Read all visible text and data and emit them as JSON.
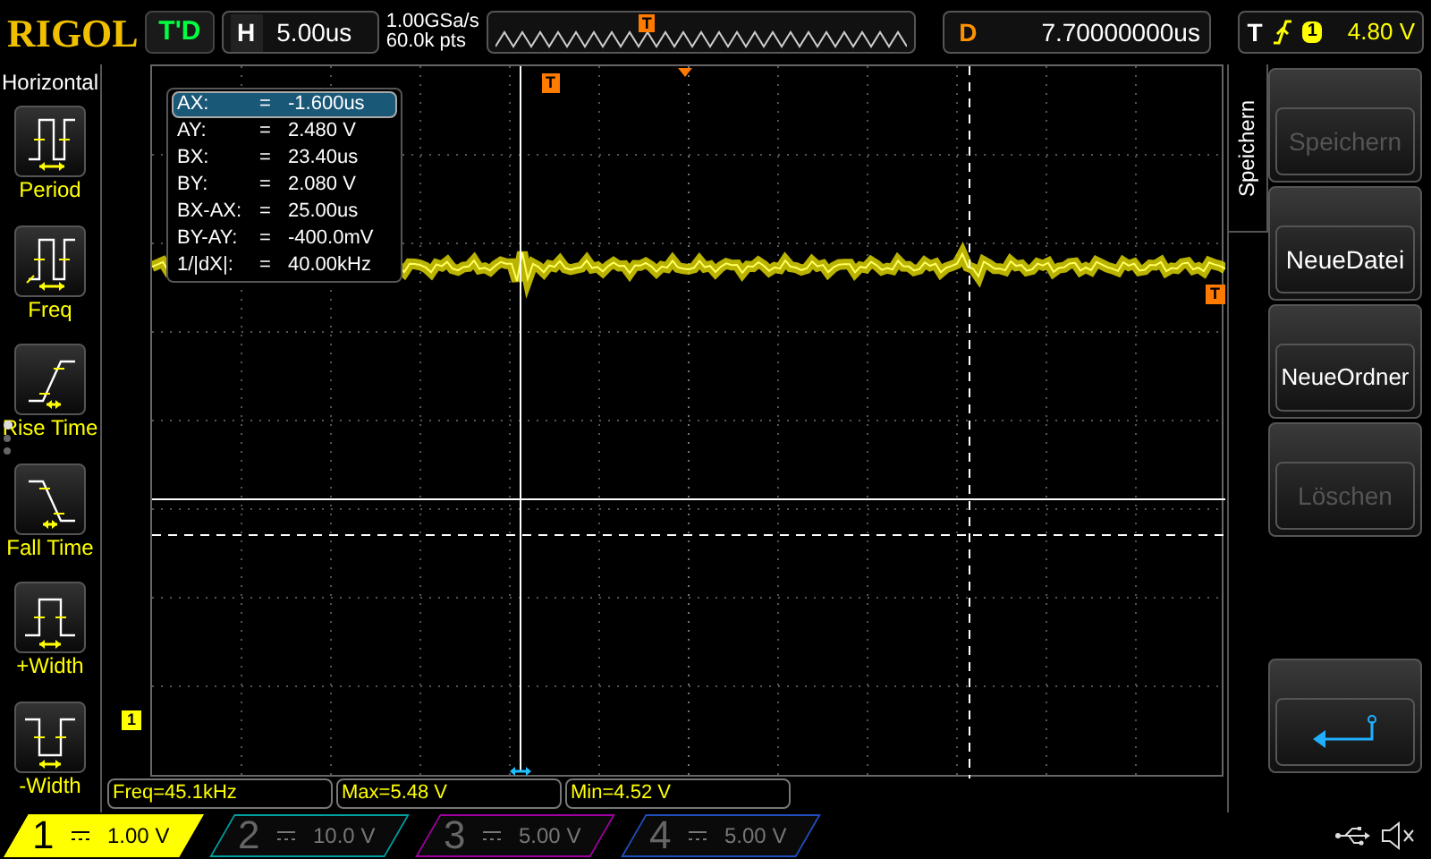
{
  "header": {
    "logo": "RIGOL",
    "run_status": "T'D",
    "horizontal": {
      "label": "H",
      "scale": "5.00us"
    },
    "sample_rate": "1.00GSa/s",
    "memory_depth": "60.0k pts",
    "trigger_position": "T",
    "delay": {
      "label": "D",
      "value": "7.70000000us"
    },
    "trigger": {
      "label": "T",
      "source": "1",
      "level": "4.80 V"
    }
  },
  "sidebar": {
    "title": "Horizontal",
    "measurements": [
      {
        "kind": "period",
        "label": "Period"
      },
      {
        "kind": "freq",
        "label": "Freq"
      },
      {
        "kind": "rise",
        "label": "Rise Time"
      },
      {
        "kind": "fall",
        "label": "Fall Time"
      },
      {
        "kind": "pwidth",
        "label": "+Width"
      },
      {
        "kind": "nwidth",
        "label": "-Width"
      }
    ],
    "pages": [
      {
        "selected": true
      },
      {
        "selected": false
      },
      {
        "selected": false
      }
    ]
  },
  "plot": {
    "trigger_marker": "T",
    "channel_marker": "1",
    "trigger_level_marker": "T",
    "cursor_table": [
      {
        "name": "AX:",
        "eq": "=",
        "value": "-1.600us",
        "selected": true
      },
      {
        "name": "AY:",
        "eq": "=",
        "value": "2.480 V",
        "selected": false
      },
      {
        "name": "BX:",
        "eq": "=",
        "value": "23.40us",
        "selected": false
      },
      {
        "name": "BY:",
        "eq": "=",
        "value": "2.080 V",
        "selected": false
      },
      {
        "name": "BX-AX:",
        "eq": "=",
        "value": "25.00us",
        "selected": false
      },
      {
        "name": "BY-AY:",
        "eq": "=",
        "value": "-400.0mV",
        "selected": false
      },
      {
        "name": "1/|dX|:",
        "eq": "=",
        "value": "40.00kHz",
        "selected": false
      }
    ]
  },
  "menu": {
    "title": "Speichern",
    "buttons": [
      {
        "label": "Speichern",
        "disabled": true
      },
      {
        "label": "NeueDatei",
        "disabled": false
      },
      {
        "label": "NeueOrdner",
        "disabled": false
      },
      {
        "label": "Löschen",
        "disabled": true
      }
    ]
  },
  "readouts": [
    "Freq=45.1kHz",
    "Max=5.48 V",
    "Min=4.52 V"
  ],
  "channels": [
    {
      "number": "1",
      "scale": "1.00 V",
      "on": true,
      "color": "#ffff00"
    },
    {
      "number": "2",
      "scale": "10.0 V",
      "on": false,
      "color": "#00a0a0"
    },
    {
      "number": "3",
      "scale": "5.00 V",
      "on": false,
      "color": "#a000a0"
    },
    {
      "number": "4",
      "scale": "5.00 V",
      "on": false,
      "color": "#2050c0"
    }
  ]
}
